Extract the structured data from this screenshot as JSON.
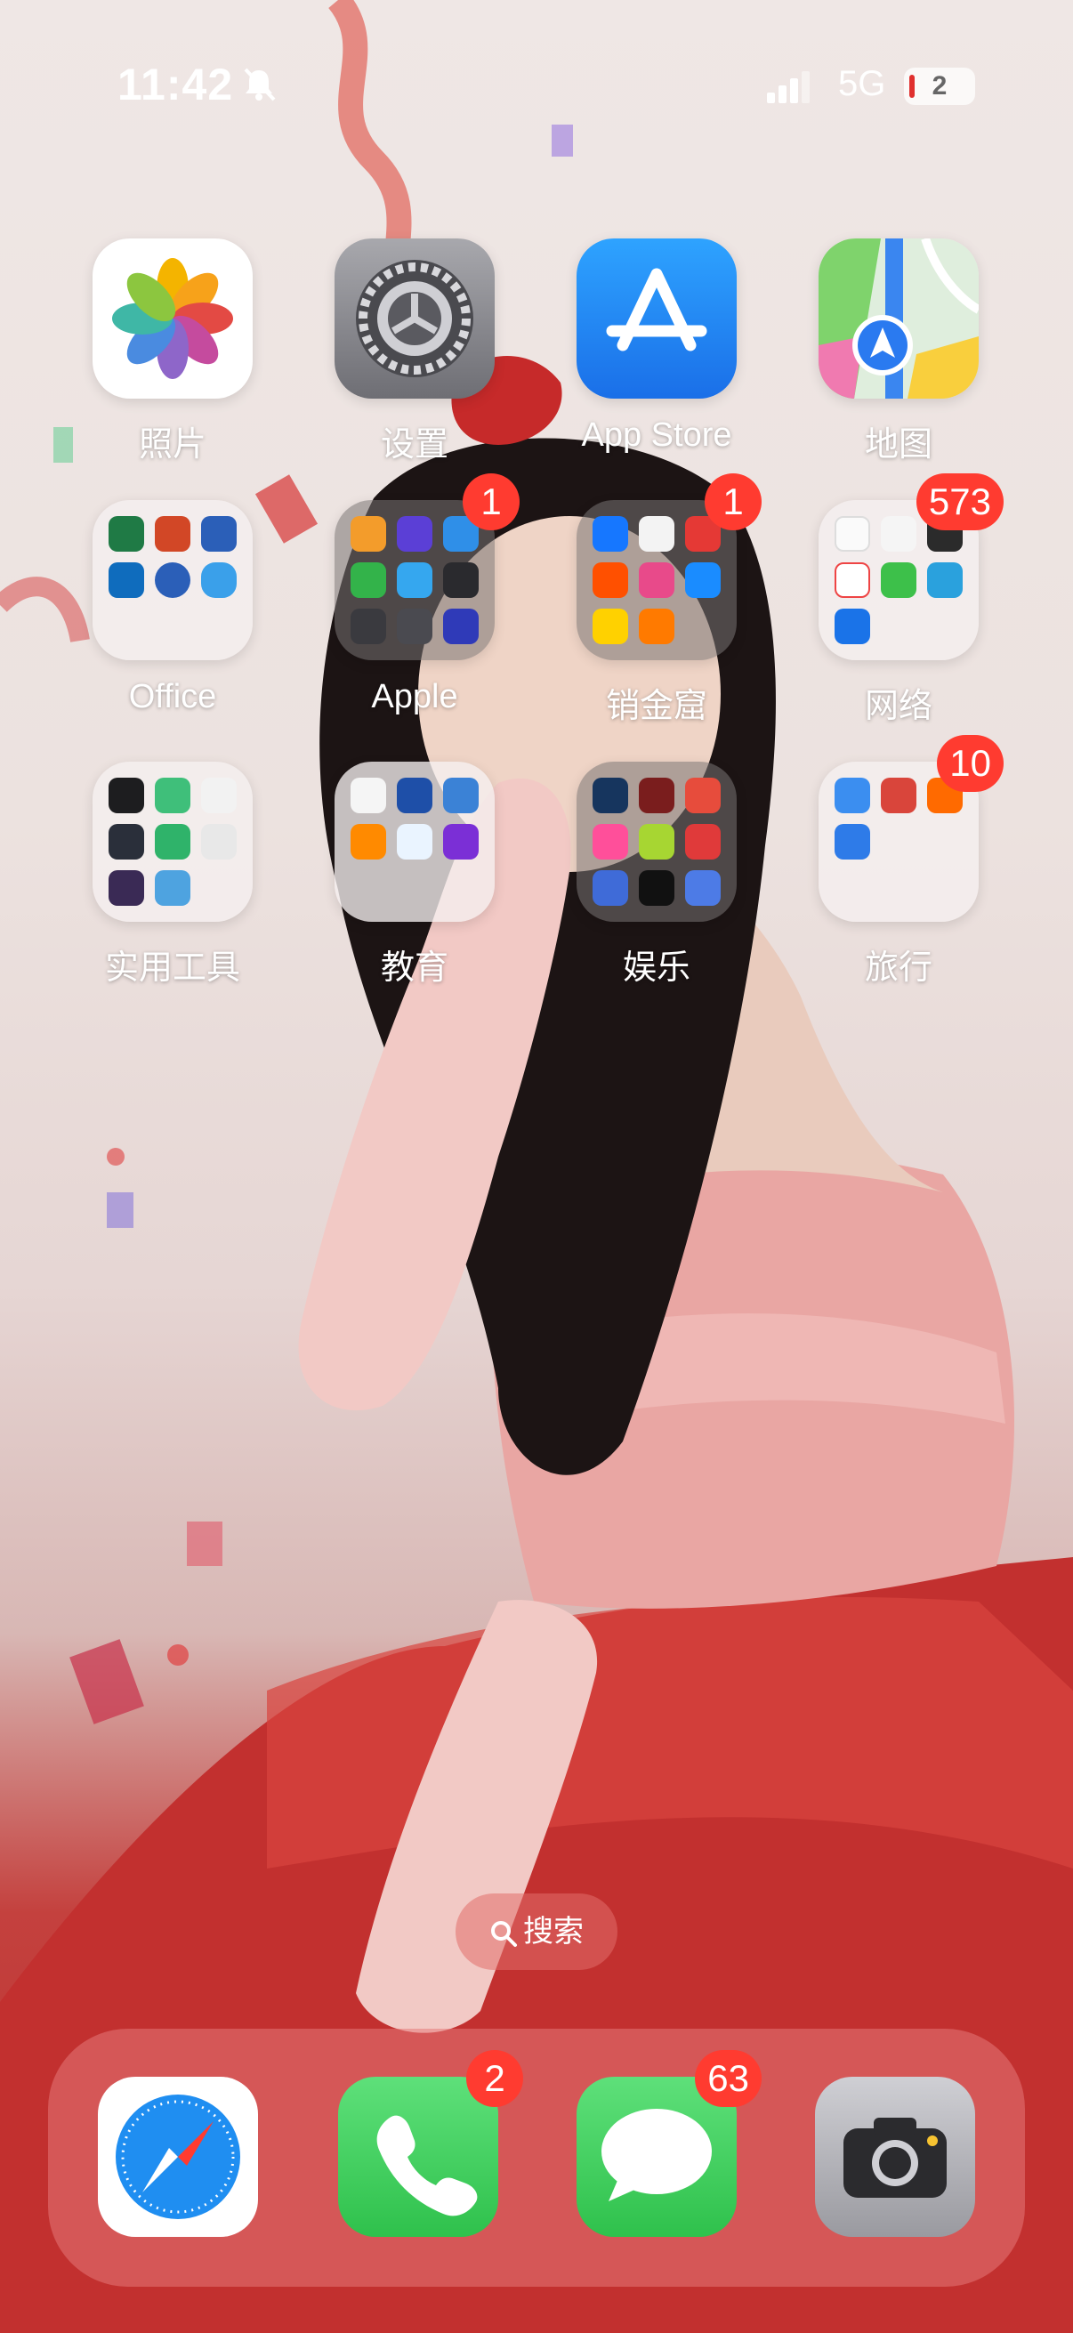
{
  "status_bar": {
    "time": "11:42",
    "network": "5G",
    "battery_level": "2",
    "icons": [
      "bell-slash-icon",
      "cellular-signal-icon",
      "battery-icon"
    ]
  },
  "apps": {
    "photos": {
      "label": "照片",
      "icon": "photos-icon"
    },
    "settings": {
      "label": "设置",
      "icon": "gear-icon"
    },
    "app_store": {
      "label": "App Store",
      "icon": "app-store-icon"
    },
    "maps": {
      "label": "地图",
      "icon": "maps-icon"
    },
    "office": {
      "label": "Office",
      "icon": "folder-icon"
    },
    "apple": {
      "label": "Apple",
      "badge": "1",
      "icon": "folder-icon"
    },
    "xiaojinku": {
      "label": "销金窟",
      "badge": "1",
      "icon": "folder-icon"
    },
    "wangluo": {
      "label": "网络",
      "badge": "573",
      "icon": "folder-icon"
    },
    "tools": {
      "label": "实用工具",
      "icon": "folder-icon"
    },
    "education": {
      "label": "教育",
      "icon": "folder-icon"
    },
    "entertainment": {
      "label": "娱乐",
      "icon": "folder-icon"
    },
    "travel": {
      "label": "旅行",
      "badge": "10",
      "icon": "folder-icon"
    }
  },
  "search": {
    "label": "搜索",
    "icon": "search-icon"
  },
  "dock": {
    "safari": {
      "icon": "safari-icon"
    },
    "phone": {
      "badge": "2",
      "icon": "phone-icon"
    },
    "messages": {
      "badge": "63",
      "icon": "messages-icon"
    },
    "camera": {
      "icon": "camera-icon"
    }
  },
  "colors": {
    "badge": "#ff3b30",
    "dock": "#e67878",
    "wallpaper_dress": "#c4413e"
  }
}
